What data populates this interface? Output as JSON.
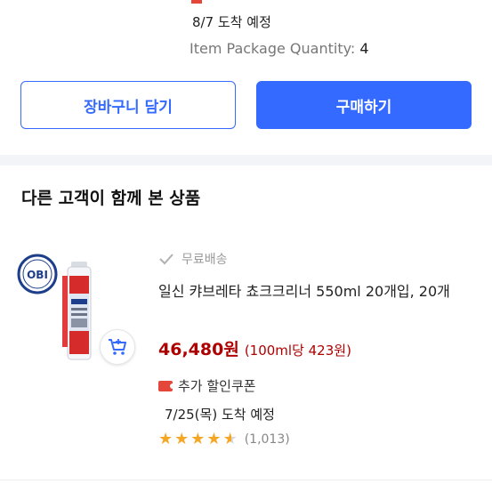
{
  "delivery": {
    "arrival": "8/7 도착 예정",
    "qty_label": "Item Package Quantity:",
    "qty_value": "4"
  },
  "actions": {
    "cart_label": "장바구니 담기",
    "buy_label": "구매하기"
  },
  "recommend": {
    "section_title": "다른 고객이 함께 본 상품",
    "product": {
      "logo_text": "OBI",
      "free_shipping": "무료배송",
      "title": "일신 캬브레타 쵸크크리너 550ml 20개입, 20개",
      "price": "46,480원",
      "unit_price": "(100ml당 423원)",
      "coupon": "추가 할인쿠폰",
      "arrival": "7/25(목) 도착 예정",
      "rating": 4.5,
      "review_count": "(1,013)"
    }
  },
  "colors": {
    "accent": "#346aff",
    "price": "#ae0000",
    "star": "#f5a623"
  }
}
